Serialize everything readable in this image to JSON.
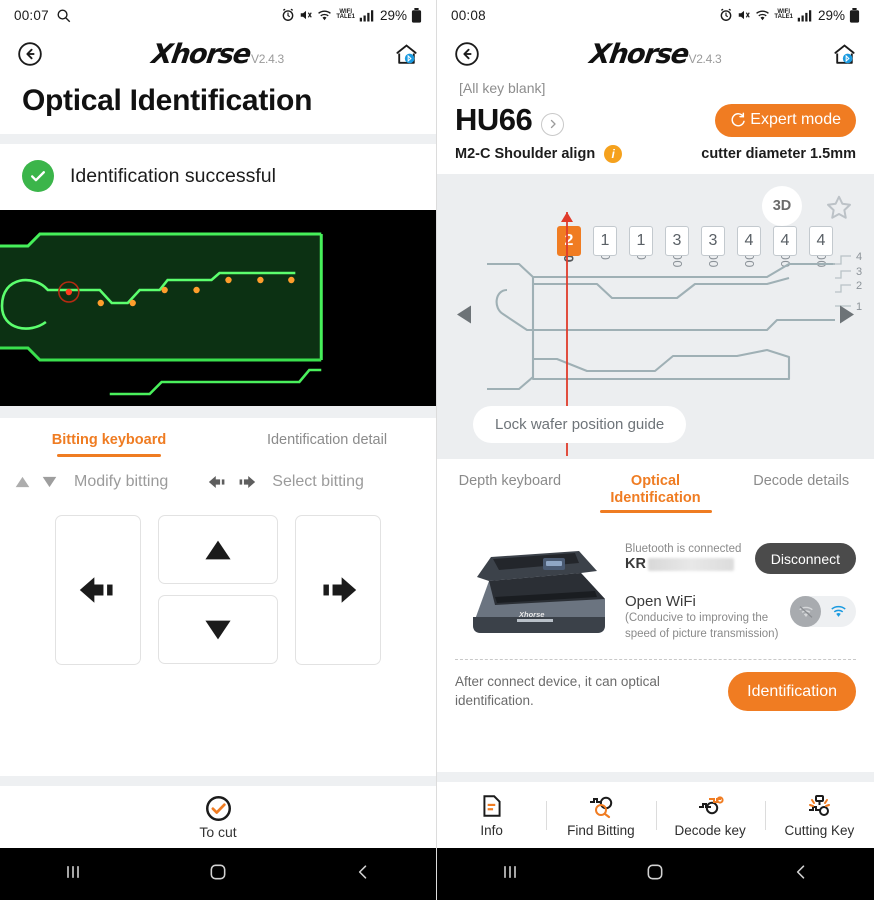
{
  "left": {
    "statusbar": {
      "time": "00:07",
      "battery": "29%",
      "icons": [
        "search-icon",
        "alarm-icon",
        "mute-icon",
        "wifi-icon",
        "wifi-tale-icon",
        "signal-icon",
        "battery-icon"
      ]
    },
    "header": {
      "back": "back-icon",
      "brand": "Xhorse",
      "version": "V2.4.3",
      "home": "home-bluetooth-icon"
    },
    "page_title": "Optical Identification",
    "status": {
      "text": "Identification successful",
      "icon": "check-circle-icon",
      "color": "#3bb54a"
    },
    "scan": {
      "bitting": [
        "2",
        "1",
        "1",
        "3",
        "3",
        "4",
        "4",
        "4"
      ]
    },
    "tabs": [
      {
        "label": "Bitting keyboard",
        "active": true
      },
      {
        "label": "Identification detail",
        "active": false
      }
    ],
    "hints": [
      {
        "label": "Modify bitting",
        "icons": [
          "triangle-up-icon",
          "triangle-down-icon"
        ]
      },
      {
        "label": "Select bitting",
        "icons": [
          "arrow-left-icon",
          "arrow-right-icon"
        ]
      }
    ],
    "keypad": [
      {
        "name": "key-left",
        "icon": "arrow-left-icon"
      },
      {
        "name": "key-up",
        "icon": "triangle-up-icon"
      },
      {
        "name": "key-down",
        "icon": "triangle-down-icon"
      },
      {
        "name": "key-right",
        "icon": "arrow-right-icon"
      }
    ],
    "footer": {
      "label": "To cut",
      "icon": "check-circle-outline-icon",
      "color": "#f07c22"
    }
  },
  "right": {
    "statusbar": {
      "time": "00:08",
      "battery": "29%"
    },
    "header": {
      "brand": "Xhorse",
      "version": "V2.4.3"
    },
    "blank_label": "[All key blank]",
    "key": {
      "name": "HU66",
      "chevron": "chevron-right-icon"
    },
    "expert_button": {
      "label": "Expert mode",
      "icon": "refresh-icon",
      "color": "#f07c22"
    },
    "meta": {
      "left": "M2-C  Shoulder align",
      "info_icon": "info-icon",
      "right": "cutter diameter 1.5mm"
    },
    "diagram": {
      "d3_label": "3D",
      "star": "star-outline-icon",
      "positions": [
        "300",
        "600",
        "900",
        "1200",
        "1500",
        "1800",
        "2100",
        "2400"
      ],
      "depths": [
        "2",
        "1",
        "1",
        "3",
        "3",
        "4",
        "4",
        "4"
      ],
      "selected_index": 0,
      "depth_scale": [
        "4",
        "3",
        "2",
        "1"
      ],
      "left_arrow": "triangle-left-icon",
      "right_arrow": "triangle-right-icon",
      "guide_label": "Lock wafer position guide"
    },
    "tabs": [
      {
        "label": "Depth keyboard",
        "active": false
      },
      {
        "label": "Optical Identification",
        "active": true
      },
      {
        "label": "Decode details",
        "active": false
      }
    ],
    "device": {
      "image": "key-reader-device-image",
      "bt_status": "Bluetooth is connected",
      "bt_name": "KR",
      "disconnect_label": "Disconnect",
      "wifi_label": "Open WiFi",
      "wifi_sub": "(Conducive to improving the speed of picture transmission)",
      "wifi_off_icon": "wifi-off-icon",
      "wifi_on_icon": "wifi-on-icon"
    },
    "identify": {
      "note": "After connect device, it can optical identification.",
      "button": "Identification"
    },
    "bottomnav": [
      {
        "label": "Info",
        "icon": "info-doc-icon"
      },
      {
        "label": "Find Bitting",
        "icon": "find-bitting-icon"
      },
      {
        "label": "Decode key",
        "icon": "decode-key-icon"
      },
      {
        "label": "Cutting Key",
        "icon": "cutting-key-icon"
      }
    ]
  },
  "navbar": {
    "recents": "recents-icon",
    "home": "home-icon",
    "back": "back-icon"
  }
}
